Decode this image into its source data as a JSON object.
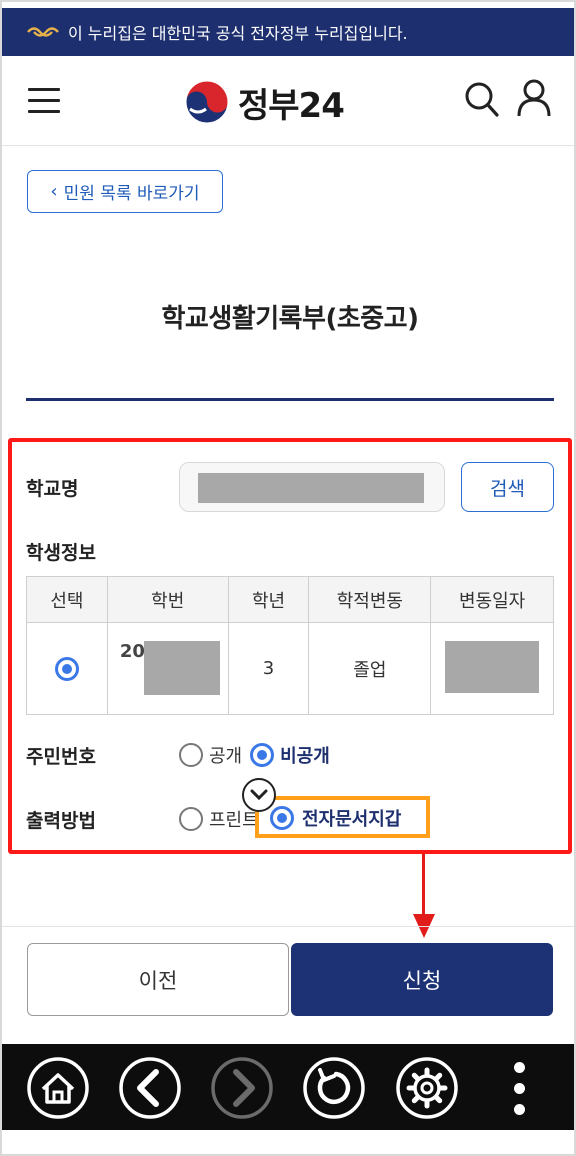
{
  "banner": {
    "text": "이 누리집은 대한민국 공식 전자정부 누리집입니다."
  },
  "header": {
    "logo_text": "정부24"
  },
  "back_button": {
    "label": "민원 목록 바로가기"
  },
  "page": {
    "title": "학교생활기록부(초중고)"
  },
  "form": {
    "school_label": "학교명",
    "search_label": "검색",
    "student_info_label": "학생정보",
    "table": {
      "headers": [
        "선택",
        "학번",
        "학년",
        "학적변동",
        "변동일자"
      ],
      "row": {
        "student_no_prefix": "20",
        "grade": "3",
        "status": "졸업"
      }
    },
    "rrn": {
      "label": "주민번호",
      "options": [
        "공개",
        "비공개"
      ],
      "selected": "비공개"
    },
    "output": {
      "label": "출력방법",
      "options": [
        "프린터",
        "전자문서지갑"
      ],
      "selected": "전자문서지갑",
      "visible_printer_text": "프린트"
    }
  },
  "buttons": {
    "prev": "이전",
    "apply": "신청"
  },
  "colors": {
    "navy": "#1d2f6f",
    "blue": "#2b6fd1",
    "red_highlight": "#ff1a1a",
    "orange_highlight": "#ff9f1a"
  }
}
